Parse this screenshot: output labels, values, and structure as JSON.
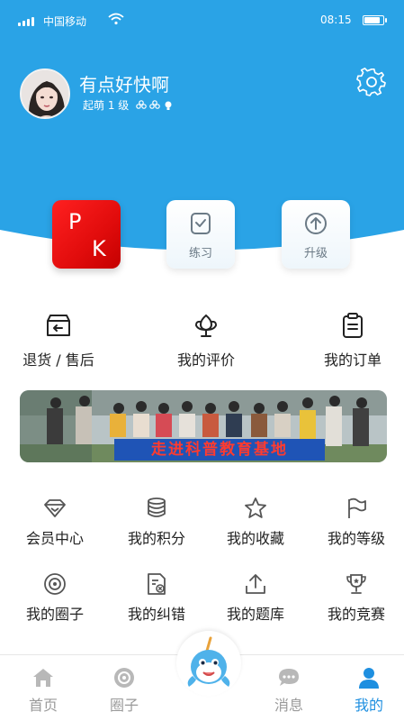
{
  "status_bar": {
    "carrier": "中国移动",
    "time": "08:15",
    "battery_level": 0.9,
    "signal_bars": 4
  },
  "profile": {
    "username": "有点好快啊",
    "level_text": "起萌 1 级",
    "level_badges": [
      "flower-icon",
      "flower-icon",
      "bulb-icon"
    ]
  },
  "tiles": {
    "pk": {
      "letter_p": "P",
      "letter_k": "K"
    },
    "practice": {
      "label": "练习"
    },
    "upgrade": {
      "label": "升级"
    }
  },
  "quick_actions": [
    {
      "label": "退货 / 售后",
      "icon": "return-box-icon"
    },
    {
      "label": "我的评价",
      "icon": "tulip-icon"
    },
    {
      "label": "我的订单",
      "icon": "clipboard-icon"
    }
  ],
  "banner": {
    "text": "走进科普教育基地"
  },
  "menu": [
    {
      "label": "会员中心",
      "icon": "diamond-icon"
    },
    {
      "label": "我的积分",
      "icon": "coins-icon"
    },
    {
      "label": "我的收藏",
      "icon": "star-icon"
    },
    {
      "label": "我的等级",
      "icon": "flag-icon"
    },
    {
      "label": "我的圈子",
      "icon": "circle-icon"
    },
    {
      "label": "我的纠错",
      "icon": "error-doc-icon"
    },
    {
      "label": "我的题库",
      "icon": "upload-icon"
    },
    {
      "label": "我的竞赛",
      "icon": "trophy-icon"
    }
  ],
  "tabbar": [
    {
      "label": "首页",
      "icon": "home-icon",
      "active": false
    },
    {
      "label": "圈子",
      "icon": "circle-icon",
      "active": false
    },
    {
      "label": "",
      "icon": "narwhal-mascot-icon",
      "active": false
    },
    {
      "label": "消息",
      "icon": "chat-icon",
      "active": false
    },
    {
      "label": "我的",
      "icon": "user-icon",
      "active": true
    }
  ],
  "colors": {
    "header_blue": "#2aa3e6",
    "accent_blue": "#1e8fe0",
    "pk_red": "#e10c0c",
    "inactive_gray": "#9a9a9a"
  }
}
